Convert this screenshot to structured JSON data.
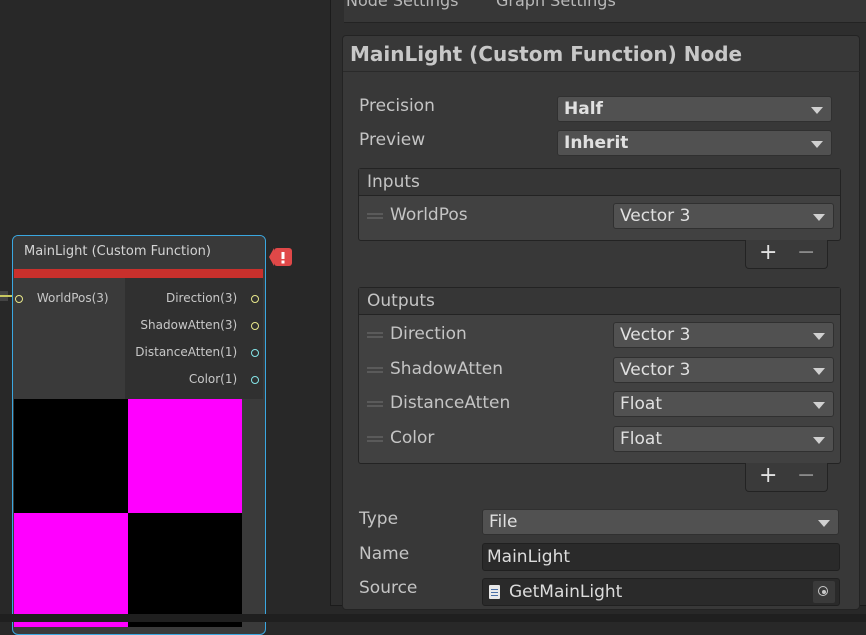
{
  "node": {
    "title": "MainLight (Custom Function)",
    "inputs": [
      {
        "label": "WorldPos(3)",
        "color": "#e6e68a"
      }
    ],
    "outputs": [
      {
        "label": "Direction(3)",
        "color": "#e6e68a"
      },
      {
        "label": "ShadowAtten(3)",
        "color": "#e6e68a"
      },
      {
        "label": "DistanceAtten(1)",
        "color": "#84e4e7"
      },
      {
        "label": "Color(1)",
        "color": "#84e4e7"
      }
    ],
    "preview_colors": [
      "#000000",
      "#ff00ff"
    ]
  },
  "tabs": {
    "node_settings": "Node Settings",
    "graph_settings": "Graph Settings"
  },
  "inspector": {
    "title": "MainLight (Custom Function) Node",
    "precision_label": "Precision",
    "precision_value": "Half",
    "preview_label": "Preview",
    "preview_value": "Inherit",
    "inputs_header": "Inputs",
    "inputs": [
      {
        "name": "WorldPos",
        "type": "Vector 3"
      }
    ],
    "outputs_header": "Outputs",
    "outputs": [
      {
        "name": "Direction",
        "type": "Vector 3"
      },
      {
        "name": "ShadowAtten",
        "type": "Vector 3"
      },
      {
        "name": "DistanceAtten",
        "type": "Float"
      },
      {
        "name": "Color",
        "type": "Float"
      }
    ],
    "plus": "+",
    "minus": "−",
    "type_label": "Type",
    "type_value": "File",
    "name_label": "Name",
    "name_value": "MainLight",
    "source_label": "Source",
    "source_value": "GetMainLight"
  },
  "colors": {
    "selection_outline": "#3aa7e0",
    "error_bar": "#c9302c",
    "warning_badge": "#e04848"
  }
}
